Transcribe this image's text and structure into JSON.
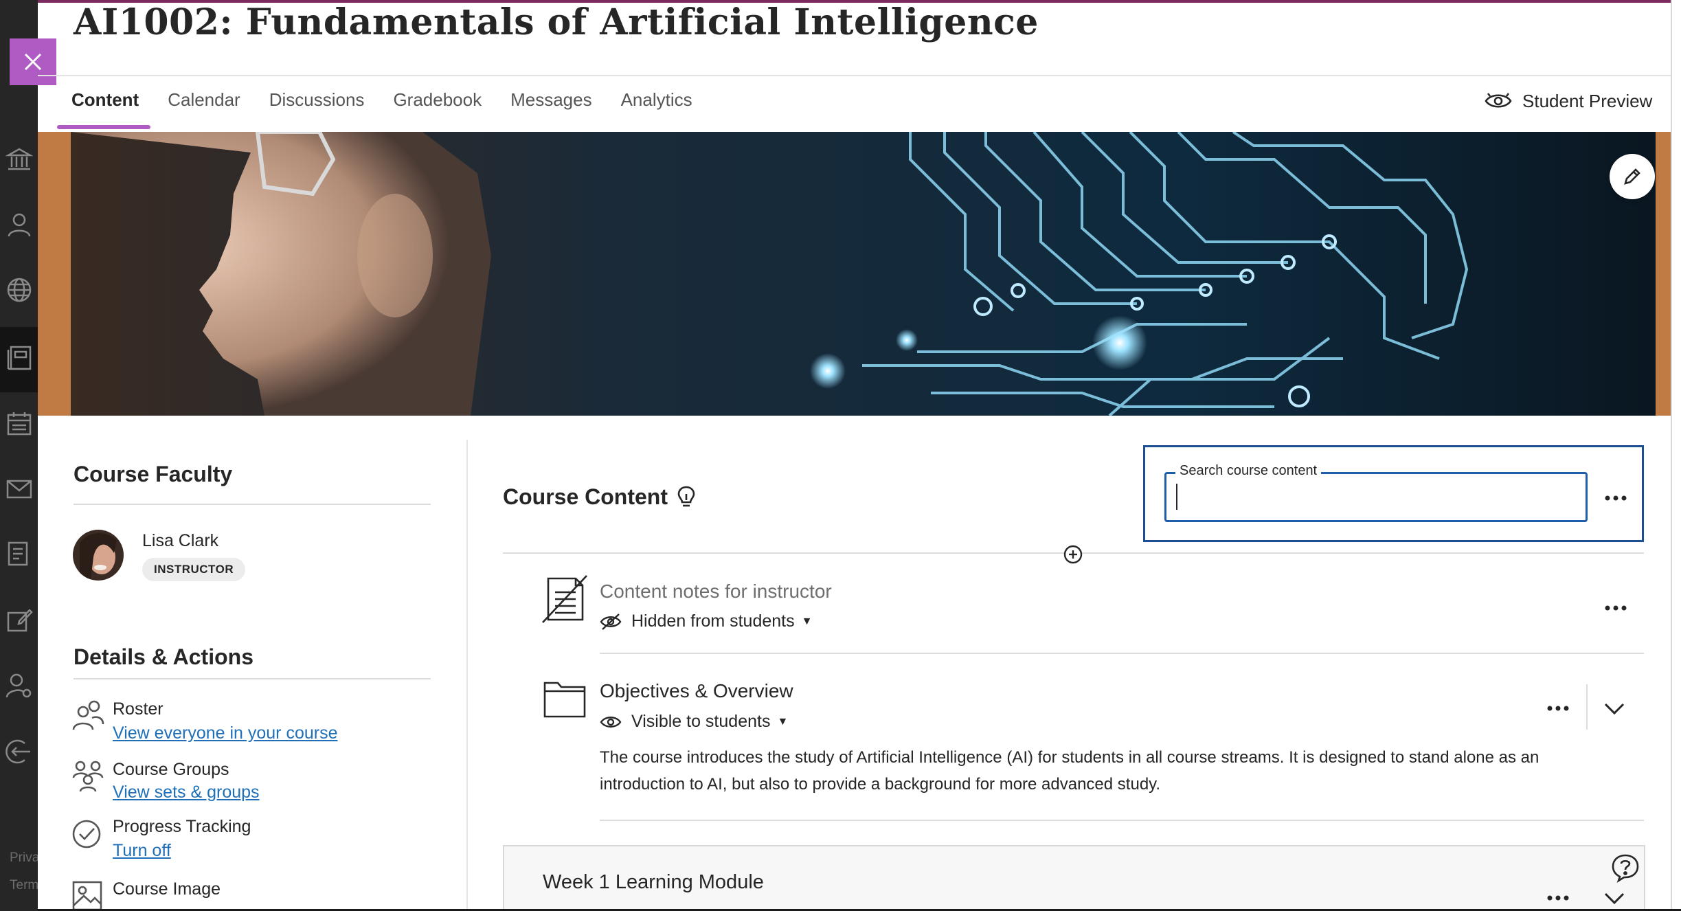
{
  "course": {
    "title": "AI1002: Fundamentals of Artificial Intelligence"
  },
  "nav": {
    "tabs": [
      {
        "label": "Content",
        "active": true
      },
      {
        "label": "Calendar"
      },
      {
        "label": "Discussions"
      },
      {
        "label": "Gradebook"
      },
      {
        "label": "Messages"
      },
      {
        "label": "Analytics"
      }
    ],
    "student_preview": "Student Preview"
  },
  "rail": {
    "icons": [
      "institution-icon",
      "profile-icon",
      "globe-icon",
      "courses-icon",
      "calendar-icon",
      "messages-icon",
      "grades-icon",
      "tools-icon",
      "admin-icon",
      "sign-out-icon"
    ],
    "footer_1": "Priva",
    "footer_2": "Term"
  },
  "sidebar": {
    "faculty_heading": "Course Faculty",
    "faculty": {
      "name": "Lisa Clark",
      "role": "INSTRUCTOR"
    },
    "details_heading": "Details & Actions",
    "actions": [
      {
        "label": "Roster",
        "link": "View everyone in your course",
        "icon": "roster-icon"
      },
      {
        "label": "Course Groups",
        "link": "View sets & groups",
        "icon": "groups-icon"
      },
      {
        "label": "Progress Tracking",
        "link": "Turn off",
        "icon": "progress-check-icon"
      },
      {
        "label": "Course Image",
        "link": "",
        "icon": "image-icon"
      }
    ]
  },
  "content": {
    "heading": "Course Content",
    "search": {
      "legend": "Search course content",
      "value": ""
    },
    "items": [
      {
        "title": "Content notes for instructor",
        "visibility": "Hidden from students",
        "icon": "document-icon"
      },
      {
        "title": "Objectives & Overview",
        "visibility": "Visible to students",
        "icon": "folder-icon",
        "description": "The course introduces the study of Artificial Intelligence (AI) for students in all course streams. It is designed to stand alone as an introduction to AI, but also to provide a background for more advanced study."
      }
    ],
    "module": {
      "title": "Week 1 Learning Module"
    }
  },
  "colors": {
    "accent": "#b05bc3",
    "link": "#1e6fb8",
    "search_border": "#1d4e92",
    "top_bar": "#7b2a5f",
    "rail": "#262626"
  }
}
